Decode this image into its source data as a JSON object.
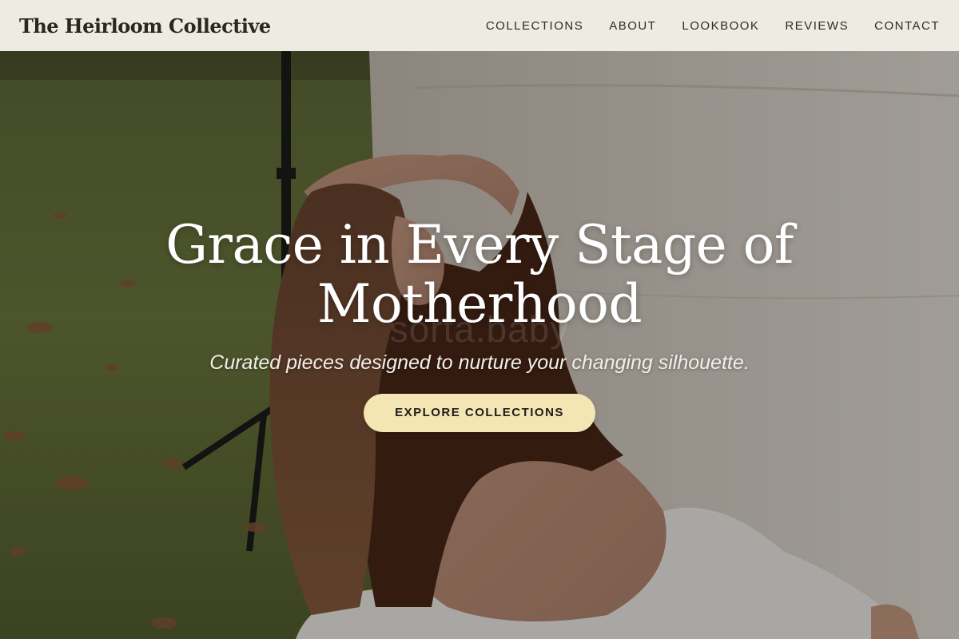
{
  "site": {
    "brand": "The Heirloom Collective"
  },
  "nav": {
    "items": [
      {
        "label": "COLLECTIONS"
      },
      {
        "label": "ABOUT"
      },
      {
        "label": "LOOKBOOK"
      },
      {
        "label": "REVIEWS"
      },
      {
        "label": "CONTACT"
      }
    ]
  },
  "hero": {
    "headline_line1": "Grace in Every Stage of",
    "headline_line2": "Motherhood",
    "tagline": "Curated pieces designed to nurture your changing silhouette.",
    "cta_label": "EXPLORE COLLECTIONS",
    "watermark": "sorta.baby",
    "image_alt": "photo-maternity-model"
  },
  "colors": {
    "nav_bg": "#f6f4ed",
    "cta_bg": "#f3e5b4",
    "headline": "#ffffff",
    "brand_text": "#2b2620"
  }
}
